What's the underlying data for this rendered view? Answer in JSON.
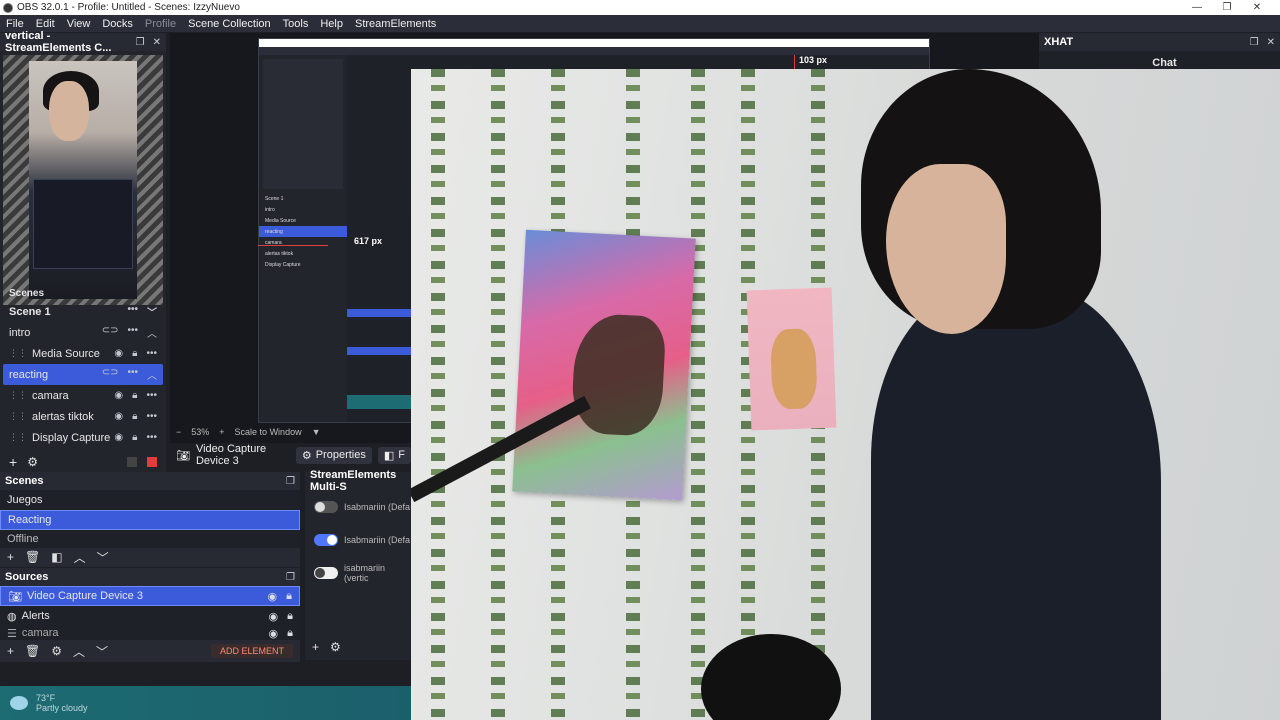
{
  "window": {
    "title": "OBS 32.0.1 - Profile: Untitled - Scenes: IzzyNuevo",
    "controls": [
      "—",
      "❐",
      "✕"
    ]
  },
  "menu": [
    "File",
    "Edit",
    "View",
    "Docks",
    "Profile",
    "Scene Collection",
    "Tools",
    "Help",
    "StreamElements"
  ],
  "vertical_dock": {
    "title": "vertical - StreamElements C...",
    "scenes_header": "Scenes",
    "rows": [
      {
        "label": "Scene 1",
        "kind": "scene"
      },
      {
        "label": "intro",
        "kind": "group"
      },
      {
        "label": "Media Source",
        "kind": "source"
      },
      {
        "label": "reacting",
        "kind": "group",
        "selected": true
      },
      {
        "label": "camara",
        "kind": "source"
      },
      {
        "label": "alertas tiktok",
        "kind": "source"
      },
      {
        "label": "Display Capture",
        "kind": "source"
      }
    ]
  },
  "preview": {
    "measure_right": "103 px",
    "measure_bottom": "617 px",
    "zoom": "53%",
    "scale_mode": "Scale to Window",
    "nested_rows": [
      "Scene 1",
      "intro",
      "Media Source",
      "reacting",
      "camara",
      "alertas tiktok",
      "Display Capture"
    ]
  },
  "source_toolbar": {
    "source_name": "Video Capture Device 3",
    "properties_label": "Properties",
    "filters_label": "F"
  },
  "scenes_dock": {
    "title": "Scenes",
    "items": [
      "Juegos",
      "Reacting",
      "Offline"
    ],
    "selected": "Reacting"
  },
  "sources_dock": {
    "title": "Sources",
    "items": [
      "Video Capture Device 3",
      "Alerts",
      "camara"
    ],
    "selected": "Video Capture Device 3",
    "add_element": "ADD ELEMENT"
  },
  "multistream": {
    "title": "StreamElements Multi-S",
    "rows": [
      {
        "account": "Isabmariin (Defa",
        "enabled": false
      },
      {
        "account": "Isabmariin (Defa",
        "enabled": true
      },
      {
        "account": "isabmariin (vertic",
        "enabled": false
      }
    ]
  },
  "chat_dock": {
    "title": "XHAT",
    "body": "Chat"
  },
  "weather": {
    "temp": "73°F",
    "desc": "Partly cloudy"
  },
  "colors": {
    "accent": "#3b5bdb",
    "panel": "#272a33",
    "record": "#e23c3c"
  }
}
